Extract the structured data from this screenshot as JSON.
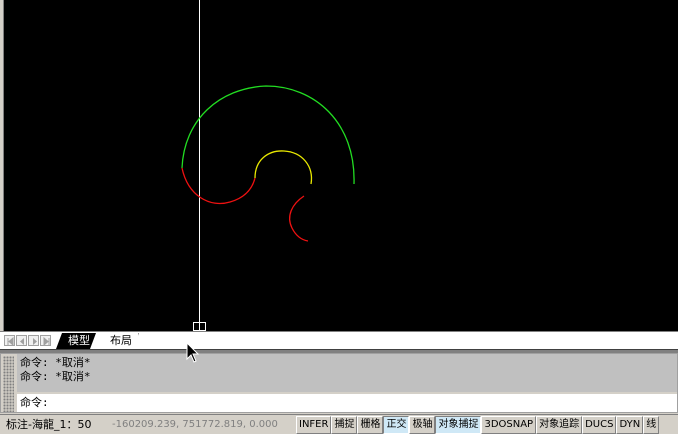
{
  "drawing": {
    "background": "#000000",
    "crosshair_color": "#ffffff",
    "arcs": [
      {
        "name": "outer-green-arc",
        "color": "#22dd22"
      },
      {
        "name": "left-red-arc",
        "color": "#ee1111"
      },
      {
        "name": "inner-yellow-arc",
        "color": "#e8e800"
      },
      {
        "name": "hook-red-arc",
        "color": "#ee1111"
      }
    ]
  },
  "tabs": {
    "model": "模型",
    "layout": "布局"
  },
  "command": {
    "history": [
      "命令: *取消*",
      "命令: *取消*"
    ],
    "prompt": "命令:",
    "value": ""
  },
  "status": {
    "annotation_scale": "标注-海龍_1：50",
    "coordinates": "-160209.239, 751772.819, 0.000",
    "toggles": [
      {
        "label": "INFER",
        "on": false
      },
      {
        "label": "捕捉",
        "on": false
      },
      {
        "label": "栅格",
        "on": false
      },
      {
        "label": "正交",
        "on": true
      },
      {
        "label": "极轴",
        "on": false
      },
      {
        "label": "对象捕捉",
        "on": true
      },
      {
        "label": "3DOSNAP",
        "on": false
      },
      {
        "label": "对象追踪",
        "on": false
      },
      {
        "label": "DUCS",
        "on": false
      },
      {
        "label": "DYN",
        "on": false
      },
      {
        "label": "线",
        "on": false
      }
    ]
  },
  "colors": {
    "toggle_on": "#cfe8f6",
    "panel": "#d4d0c8"
  }
}
